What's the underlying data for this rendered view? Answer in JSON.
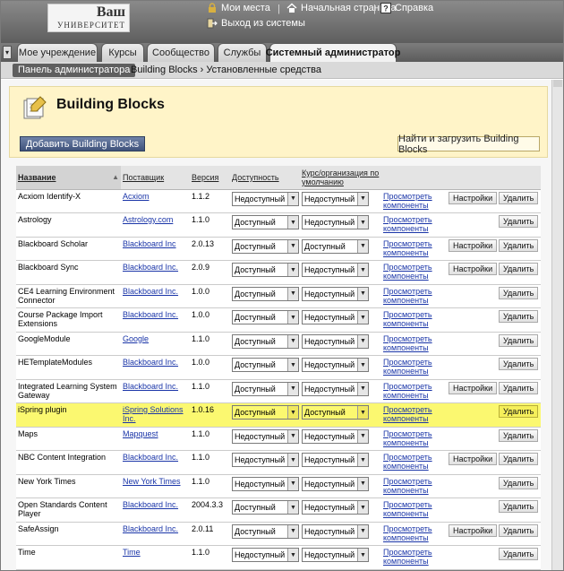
{
  "header": {
    "logo_line1": "Ваш",
    "logo_line2": "УНИВЕРСИТЕТ",
    "links": {
      "my_places": "Мои места",
      "home": "Начальная страница",
      "help": "Справка",
      "logout": "Выход из системы"
    }
  },
  "tabs": [
    {
      "label": "Мое учреждение"
    },
    {
      "label": "Курсы"
    },
    {
      "label": "Сообщество"
    },
    {
      "label": "Службы"
    },
    {
      "label": "Системный администратор"
    }
  ],
  "breadcrumb": {
    "panel": "Панель администратора",
    "trail": "Building Blocks › Установленные средства"
  },
  "page": {
    "title": "Building Blocks",
    "add_button": "Добавить Building Blocks",
    "find_button": "Найти и загрузить Building Blocks"
  },
  "table": {
    "headers": {
      "name": "Название",
      "vendor": "Поставщик",
      "version": "Версия",
      "availability": "Доступность",
      "course_default_1": "Курс/организация по",
      "course_default_2": "умолчанию"
    },
    "view_link_1": "Просмотреть",
    "view_link_2": "компоненты",
    "settings_label": "Настройки",
    "delete_label": "Удалить",
    "rows": [
      {
        "name": "Acxiom Identify-X",
        "vendor": "Acxiom",
        "version": "1.1.2",
        "avail": "Недоступный",
        "course": "Недоступный",
        "settings": true
      },
      {
        "name": "Astrology",
        "vendor": "Astrology.com",
        "version": "1.1.0",
        "avail": "Доступный",
        "course": "Недоступный",
        "settings": false
      },
      {
        "name": "Blackboard Scholar",
        "vendor": "Blackboard Inc",
        "version": "2.0.13",
        "avail": "Доступный",
        "course": "Доступный",
        "settings": true
      },
      {
        "name": "Blackboard Sync",
        "vendor": "Blackboard Inc.",
        "version": "2.0.9",
        "avail": "Доступный",
        "course": "Недоступный",
        "settings": true
      },
      {
        "name": "CE4 Learning Environment Connector",
        "vendor": "Blackboard Inc.",
        "version": "1.0.0",
        "avail": "Доступный",
        "course": "Недоступный",
        "settings": false
      },
      {
        "name": "Course Package Import Extensions",
        "vendor": "Blackboard Inc.",
        "version": "1.0.0",
        "avail": "Доступный",
        "course": "Недоступный",
        "settings": false
      },
      {
        "name": "GoogleModule",
        "vendor": "Google",
        "version": "1.1.0",
        "avail": "Доступный",
        "course": "Недоступный",
        "settings": false
      },
      {
        "name": "HETemplateModules",
        "vendor": "Blackboard Inc.",
        "version": "1.0.0",
        "avail": "Доступный",
        "course": "Недоступный",
        "settings": false
      },
      {
        "name": "Integrated Learning System Gateway",
        "vendor": "Blackboard Inc.",
        "version": "1.1.0",
        "avail": "Доступный",
        "course": "Недоступный",
        "settings": true
      },
      {
        "name": "iSpring plugin",
        "vendor": "iSpring Solutions Inc.",
        "version": "1.0.16",
        "avail": "Доступный",
        "course": "Доступный",
        "settings": false,
        "highlight": true
      },
      {
        "name": "Maps",
        "vendor": "Mapquest",
        "version": "1.1.0",
        "avail": "Недоступный",
        "course": "Недоступный",
        "settings": false
      },
      {
        "name": "NBC Content Integration",
        "vendor": "Blackboard Inc.",
        "version": "1.1.0",
        "avail": "Недоступный",
        "course": "Недоступный",
        "settings": true
      },
      {
        "name": "New York Times",
        "vendor": "New York Times",
        "version": "1.1.0",
        "avail": "Недоступный",
        "course": "Недоступный",
        "settings": false
      },
      {
        "name": "Open Standards Content Player",
        "vendor": "Blackboard Inc.",
        "version": "2004.3.3",
        "avail": "Доступный",
        "course": "Недоступный",
        "settings": false
      },
      {
        "name": "SafeAssign",
        "vendor": "Blackboard Inc.",
        "version": "2.0.11",
        "avail": "Доступный",
        "course": "Недоступный",
        "settings": true
      },
      {
        "name": "Time",
        "vendor": "Time",
        "version": "1.1.0",
        "avail": "Недоступный",
        "course": "Недоступный",
        "settings": false
      }
    ]
  }
}
